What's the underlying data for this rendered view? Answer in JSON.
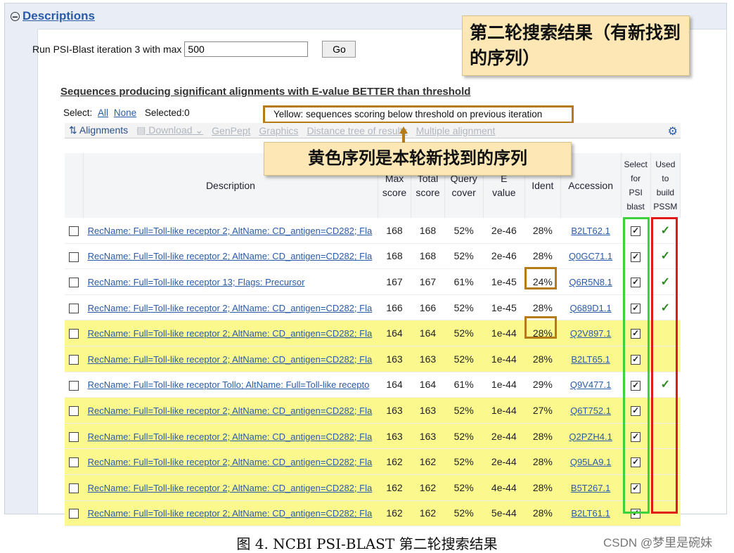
{
  "section": {
    "title": "Descriptions"
  },
  "run": {
    "label": "Run PSI-Blast iteration 3 with max",
    "value": "500",
    "button": "Go"
  },
  "seq_title": "Sequences producing significant alignments with E-value BETTER than threshold",
  "select": {
    "label": "Select:",
    "all": "All",
    "none": "None",
    "selected": "Selected:0"
  },
  "yellow_note": "Yellow: sequences scoring below threshold on previous iteration",
  "toolbar": {
    "alignments": "Alignments",
    "download": "Download",
    "genpept": "GenPept",
    "graphics": "Graphics",
    "distance": "Distance tree of results",
    "multiple": "Multiple alignment"
  },
  "callouts": {
    "top": "第二轮搜索结果（有新找到的序列）",
    "middle": "黄色序列是本轮新找到的序列"
  },
  "headers": {
    "description": "Description",
    "max1": "Max",
    "max2": "score",
    "total1": "Total",
    "total2": "score",
    "query1": "Query",
    "query2": "cover",
    "e1": "E",
    "e2": "value",
    "ident": "Ident",
    "accession": "Accession",
    "sel1": "Select",
    "sel2": "for",
    "sel3": "PSI",
    "sel4": "blast",
    "used1": "Used",
    "used2": "to",
    "used3": "build",
    "used4": "PSSM"
  },
  "rows": [
    {
      "desc": "RecName: Full=Toll-like receptor 2; AltName: CD_antigen=CD282; Fla",
      "max": "168",
      "total": "168",
      "cover": "52%",
      "e": "2e-46",
      "ident": "28%",
      "acc": "B2LT62.1",
      "highlight": false,
      "pssm": true
    },
    {
      "desc": "RecName: Full=Toll-like receptor 2; AltName: CD_antigen=CD282; Fla",
      "max": "168",
      "total": "168",
      "cover": "52%",
      "e": "2e-46",
      "ident": "28%",
      "acc": "Q0GC71.1",
      "highlight": false,
      "pssm": true
    },
    {
      "desc": "RecName: Full=Toll-like receptor 13; Flags: Precursor",
      "max": "167",
      "total": "167",
      "cover": "61%",
      "e": "1e-45",
      "ident": "24%",
      "acc": "Q6R5N8.1",
      "highlight": false,
      "pssm": true
    },
    {
      "desc": "RecName: Full=Toll-like receptor 2; AltName: CD_antigen=CD282; Fla",
      "max": "166",
      "total": "166",
      "cover": "52%",
      "e": "1e-45",
      "ident": "28%",
      "acc": "Q689D1.1",
      "highlight": false,
      "pssm": true
    },
    {
      "desc": "RecName: Full=Toll-like receptor 2; AltName: CD_antigen=CD282; Fla",
      "max": "164",
      "total": "164",
      "cover": "52%",
      "e": "1e-44",
      "ident": "28%",
      "acc": "Q2V897.1",
      "highlight": true,
      "pssm": false
    },
    {
      "desc": "RecName: Full=Toll-like receptor 2; AltName: CD_antigen=CD282; Fla",
      "max": "163",
      "total": "163",
      "cover": "52%",
      "e": "1e-44",
      "ident": "28%",
      "acc": "B2LT65.1",
      "highlight": true,
      "pssm": false
    },
    {
      "desc": "RecName: Full=Toll-like receptor Tollo; AltName: Full=Toll-like recepto",
      "max": "164",
      "total": "164",
      "cover": "61%",
      "e": "1e-44",
      "ident": "29%",
      "acc": "Q9V477.1",
      "highlight": false,
      "pssm": true
    },
    {
      "desc": "RecName: Full=Toll-like receptor 2; AltName: CD_antigen=CD282; Fla",
      "max": "163",
      "total": "163",
      "cover": "52%",
      "e": "1e-44",
      "ident": "27%",
      "acc": "Q6T752.1",
      "highlight": true,
      "pssm": false
    },
    {
      "desc": "RecName: Full=Toll-like receptor 2; AltName: CD_antigen=CD282; Fla",
      "max": "163",
      "total": "163",
      "cover": "52%",
      "e": "2e-44",
      "ident": "28%",
      "acc": "Q2PZH4.1",
      "highlight": true,
      "pssm": false
    },
    {
      "desc": "RecName: Full=Toll-like receptor 2; AltName: CD_antigen=CD282; Fla",
      "max": "162",
      "total": "162",
      "cover": "52%",
      "e": "2e-44",
      "ident": "28%",
      "acc": "Q95LA9.1",
      "highlight": true,
      "pssm": false
    },
    {
      "desc": "RecName: Full=Toll-like receptor 2; AltName: CD_antigen=CD282; Fla",
      "max": "162",
      "total": "162",
      "cover": "52%",
      "e": "4e-44",
      "ident": "28%",
      "acc": "B5T267.1",
      "highlight": true,
      "pssm": false
    },
    {
      "desc": "RecName: Full=Toll-like receptor 2; AltName: CD_antigen=CD282; Fla",
      "max": "162",
      "total": "162",
      "cover": "52%",
      "e": "5e-44",
      "ident": "28%",
      "acc": "B2LT61.1",
      "highlight": true,
      "pssm": false
    }
  ],
  "caption": "图 4. NCBI PSI-BLAST 第二轮搜索结果",
  "watermark": "CSDN @梦里是碗妹",
  "colors": {
    "highlight": "#fbf98e",
    "link": "#2a5ba8",
    "callout": "#fde8b5",
    "orange_border": "#b57b17",
    "green_box": "#3ed13e",
    "red_box": "#e01a1a"
  }
}
